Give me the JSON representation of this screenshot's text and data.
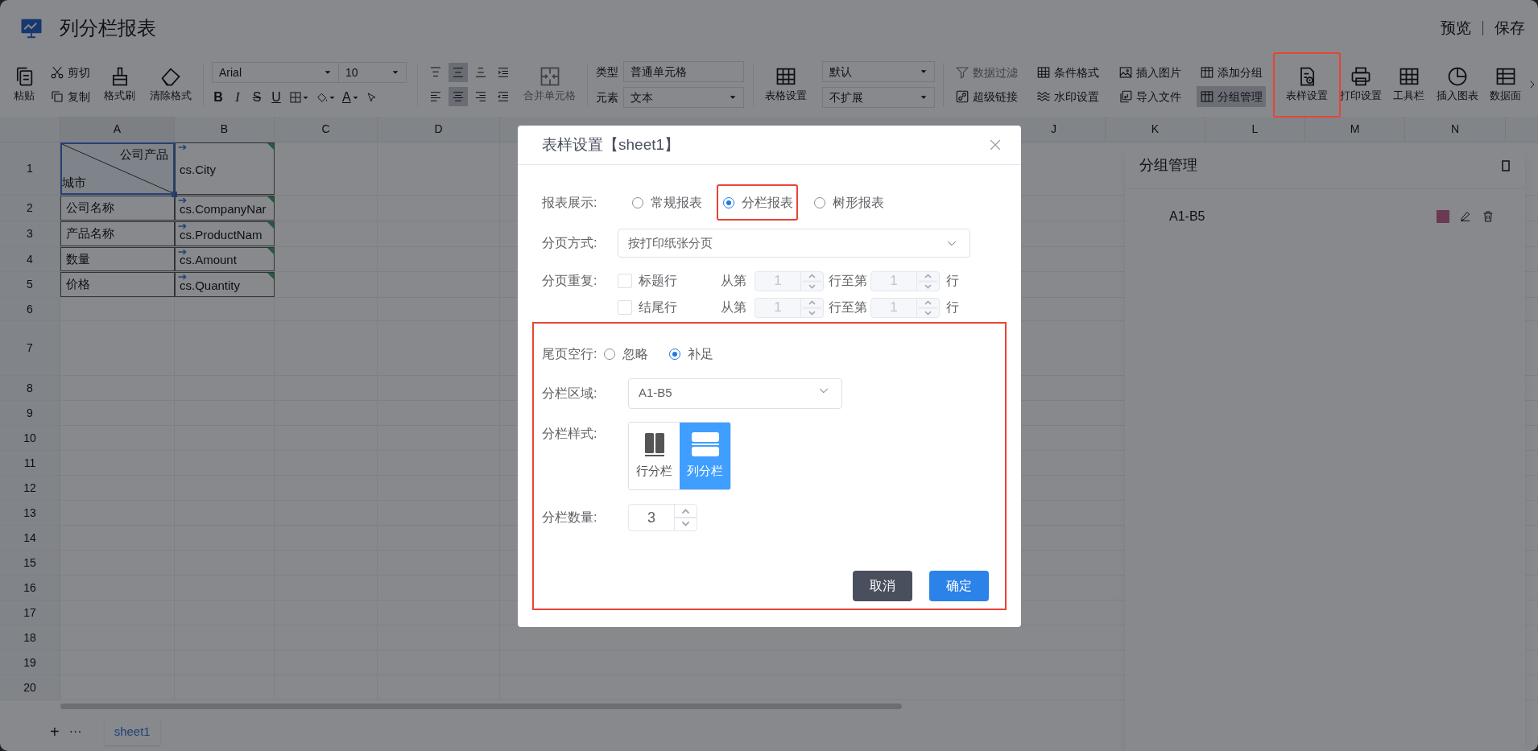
{
  "app": {
    "title": "列分栏报表",
    "actions": [
      "预览",
      "保存"
    ]
  },
  "toolbar": {
    "groups": [
      [
        {
          "kind": "big",
          "label": "粘贴",
          "disabled": false
        },
        {
          "kind": "stack",
          "items": [
            {
              "label": "剪切",
              "disabled": false,
              "active": false
            },
            {
              "label": "复制",
              "disabled": false,
              "active": false
            }
          ]
        },
        {
          "kind": "big",
          "label": "格式刷",
          "disabled": false
        },
        {
          "kind": "big",
          "label": "清除格式",
          "disabled": false
        }
      ],
      [
        {
          "kind": "font",
          "font": "Arial",
          "size": "10",
          "letters": [
            "B",
            "I",
            "S",
            "U"
          ],
          "color_letter": "A"
        }
      ],
      [
        {
          "kind": "align",
          "items": [
            {
              "selected": false
            },
            {
              "selected": true
            },
            {
              "selected": false
            },
            {
              "selected": false
            },
            {
              "selected": false
            },
            {
              "selected": true
            },
            {
              "selected": false
            },
            {
              "selected": false
            }
          ]
        },
        {
          "kind": "big",
          "label": "合并单元格",
          "disabled": true
        }
      ],
      [
        {
          "kind": "fields",
          "rows": [
            {
              "label": "类型",
              "value": "普通单元格",
              "dropdown": false
            },
            {
              "label": "元素",
              "value": "文本",
              "dropdown": true
            }
          ]
        }
      ],
      [
        {
          "kind": "big",
          "label": "表格设置",
          "disabled": false
        },
        {
          "kind": "selects",
          "options": [
            "默认",
            "不扩展"
          ]
        }
      ],
      [
        {
          "kind": "stack",
          "items": [
            {
              "label": "数据过滤",
              "disabled": true,
              "active": false
            },
            {
              "label": "超级链接",
              "disabled": false,
              "active": false
            }
          ]
        },
        {
          "kind": "stack",
          "items": [
            {
              "label": "条件格式",
              "disabled": false,
              "active": false
            },
            {
              "label": "水印设置",
              "disabled": false,
              "active": false
            }
          ]
        },
        {
          "kind": "stack",
          "items": [
            {
              "label": "插入图片",
              "disabled": false,
              "active": false
            },
            {
              "label": "导入文件",
              "disabled": false,
              "active": false
            }
          ]
        },
        {
          "kind": "stack",
          "items": [
            {
              "label": "添加分组",
              "disabled": false,
              "active": false
            },
            {
              "label": "分组管理",
              "disabled": false,
              "active": true
            }
          ]
        }
      ],
      [
        {
          "kind": "big",
          "label": "表样设置",
          "disabled": false,
          "highlighted": true
        },
        {
          "kind": "big",
          "label": "打印设置",
          "disabled": false
        },
        {
          "kind": "big",
          "label": "工具栏",
          "disabled": false
        },
        {
          "kind": "big",
          "label": "插入图表",
          "disabled": false
        },
        {
          "kind": "big",
          "label": "数据面",
          "disabled": false
        }
      ]
    ]
  },
  "sheet": {
    "columns": [
      "A",
      "B",
      "C",
      "D",
      "J",
      "K",
      "L",
      "M",
      "N"
    ],
    "rows": [
      {
        "number": "1",
        "cells": [
          {
            "kind": "diagonal",
            "top": "公司产品",
            "bottom": "城市"
          },
          {
            "kind": "field",
            "text": "cs.City"
          }
        ]
      },
      {
        "number": "2",
        "cells": [
          {
            "kind": "label",
            "text": "公司名称"
          },
          {
            "kind": "field",
            "text": "cs.CompanyNar"
          }
        ]
      },
      {
        "number": "3",
        "cells": [
          {
            "kind": "label",
            "text": "产品名称"
          },
          {
            "kind": "field",
            "text": "cs.ProductNam"
          }
        ]
      },
      {
        "number": "4",
        "cells": [
          {
            "kind": "label",
            "text": "数量"
          },
          {
            "kind": "field",
            "text": "cs.Amount"
          }
        ]
      },
      {
        "number": "5",
        "cells": [
          {
            "kind": "label",
            "text": "价格"
          },
          {
            "kind": "field",
            "text": "cs.Quantity"
          }
        ]
      },
      {
        "number": "6"
      },
      {
        "number": "7"
      },
      {
        "number": "8"
      },
      {
        "number": "9"
      },
      {
        "number": "10"
      },
      {
        "number": "11"
      },
      {
        "number": "12"
      },
      {
        "number": "13"
      },
      {
        "number": "14"
      },
      {
        "number": "15"
      },
      {
        "number": "16"
      },
      {
        "number": "17"
      },
      {
        "number": "18"
      },
      {
        "number": "19"
      },
      {
        "number": "20"
      }
    ],
    "tabs": {
      "add": "+",
      "more": "···",
      "sheets": [
        {
          "label": "sheet1",
          "selected": true
        }
      ]
    }
  },
  "group_panel": {
    "title": "分组管理",
    "groups": [
      {
        "label": "A1-B5",
        "color": "#6a3a52"
      }
    ]
  },
  "dialog": {
    "title": "表样设置【sheet1】",
    "report_display": {
      "label": "报表展示:",
      "options": [
        {
          "label": "常规报表",
          "selected": false
        },
        {
          "label": "分栏报表",
          "selected": true,
          "highlighted": true
        },
        {
          "label": "树形报表",
          "selected": false
        }
      ]
    },
    "paging": {
      "label": "分页方式:",
      "value": "按打印纸张分页"
    },
    "repeat": {
      "label": "分页重复:",
      "rows": [
        {
          "label": "标题行",
          "checked": false,
          "from_label": "从第",
          "from": "1",
          "to_label": "行至第",
          "to": "1",
          "unit": "行",
          "disabled": true
        },
        {
          "label": "结尾行",
          "checked": false,
          "from_label": "从第",
          "from": "1",
          "to_label": "行至第",
          "to": "1",
          "unit": "行",
          "disabled": true
        }
      ]
    },
    "column_section": {
      "highlighted": true,
      "last_page_blank": {
        "label": "尾页空行:",
        "options": [
          {
            "label": "忽略",
            "selected": false
          },
          {
            "label": "补足",
            "selected": true
          }
        ]
      },
      "column_area": {
        "label": "分栏区域:",
        "value": "A1-B5"
      },
      "column_style": {
        "label": "分栏样式:",
        "options": [
          {
            "label": "行分栏",
            "selected": false
          },
          {
            "label": "列分栏",
            "selected": true
          }
        ]
      },
      "column_count": {
        "label": "分栏数量:",
        "value": "3"
      }
    },
    "buttons": [
      {
        "label": "取消",
        "kind": "cancel"
      },
      {
        "label": "确定",
        "kind": "primary"
      }
    ]
  }
}
